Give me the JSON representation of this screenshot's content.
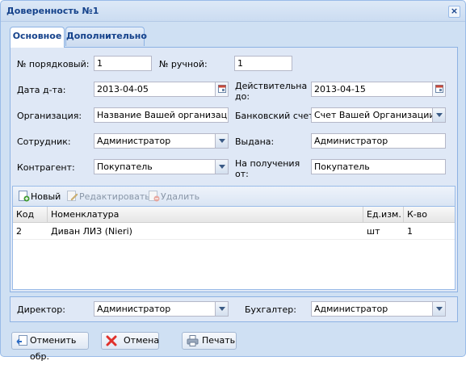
{
  "window": {
    "title": "Доверенность №1",
    "close_icon": "close-icon"
  },
  "tabs": [
    {
      "label": "Основное",
      "active": true
    },
    {
      "label": "Дополнительно",
      "active": false
    }
  ],
  "form": {
    "order_no_label": "№ порядковый:",
    "order_no_value": "1",
    "manual_no_label": "№ ручной:",
    "manual_no_value": "1",
    "date_label": "Дата д-та:",
    "date_value": "2013-04-05",
    "valid_until_label": "Действительна до:",
    "valid_until_value": "2013-04-15",
    "org_label": "Организация:",
    "org_value": "Название Вашей организации",
    "bank_label": "Банковский счет:",
    "bank_value": "Счет Вашей Организации",
    "employee_label": "Сотрудник:",
    "employee_value": "Администратор",
    "issued_label": "Выдана:",
    "issued_value": "Администратор",
    "counterparty_label": "Контрагент:",
    "counterparty_value": "Покупатель",
    "receive_label": "На получения от:",
    "receive_value": "Покупатель"
  },
  "grid": {
    "toolbar": {
      "new_label": "Новый",
      "edit_label": "Редактировать",
      "delete_label": "Удалить"
    },
    "columns": [
      "Код",
      "Номенклатура",
      "Ед.изм.",
      "К-во"
    ],
    "rows": [
      {
        "code": "2",
        "name": "Диван ЛИЗ (Nieri)",
        "unit": "шт",
        "qty": "1"
      }
    ]
  },
  "signers": {
    "director_label": "Директор:",
    "director_value": "Администратор",
    "accountant_label": "Бухгалтер:",
    "accountant_value": "Администратор"
  },
  "footer": {
    "cancel_processing_label": "Отменить обр.",
    "cancel_label": "Отмена",
    "print_label": "Печать"
  },
  "colors": {
    "window_bg": "#cfe0f3",
    "title_text": "#15428b",
    "panel_bg": "#dfe8f6",
    "border": "#8db2e3",
    "cancel_icon": "#e0312b"
  }
}
